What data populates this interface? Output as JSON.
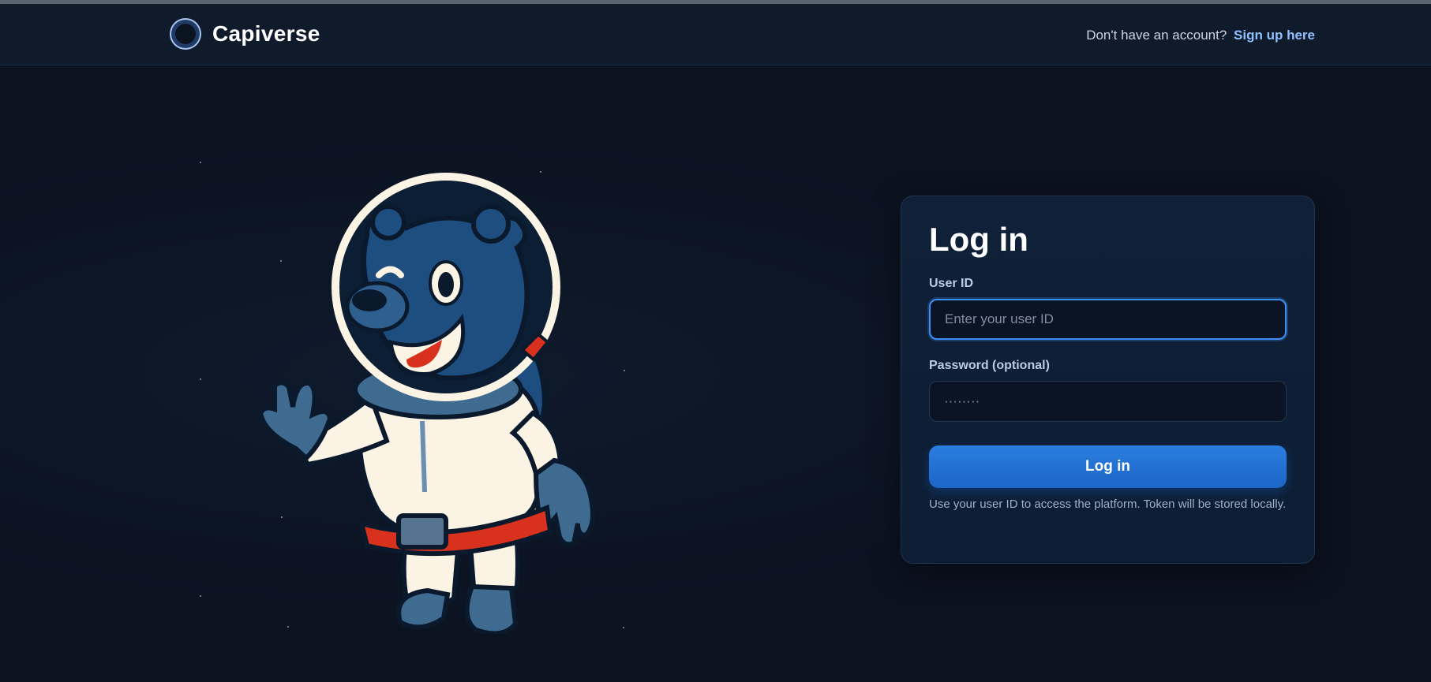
{
  "app": {
    "name": "Capiverse",
    "logo_icon": "planet-logo-icon"
  },
  "header": {
    "signup_prompt": "Don't have an account?",
    "signup_link": "Sign up here"
  },
  "login": {
    "title": "Log in",
    "user_id": {
      "label": "User ID",
      "placeholder": "Enter your user ID",
      "value": ""
    },
    "password": {
      "label": "Password (optional)",
      "placeholder": "········",
      "value": ""
    },
    "submit_label": "Log in",
    "hint": "Use your user ID to access the platform. Token will be stored locally."
  },
  "colors": {
    "background": "#0b1220",
    "card": "#0f2038",
    "accent": "#2a7ee0",
    "link": "#8fc1ff"
  }
}
